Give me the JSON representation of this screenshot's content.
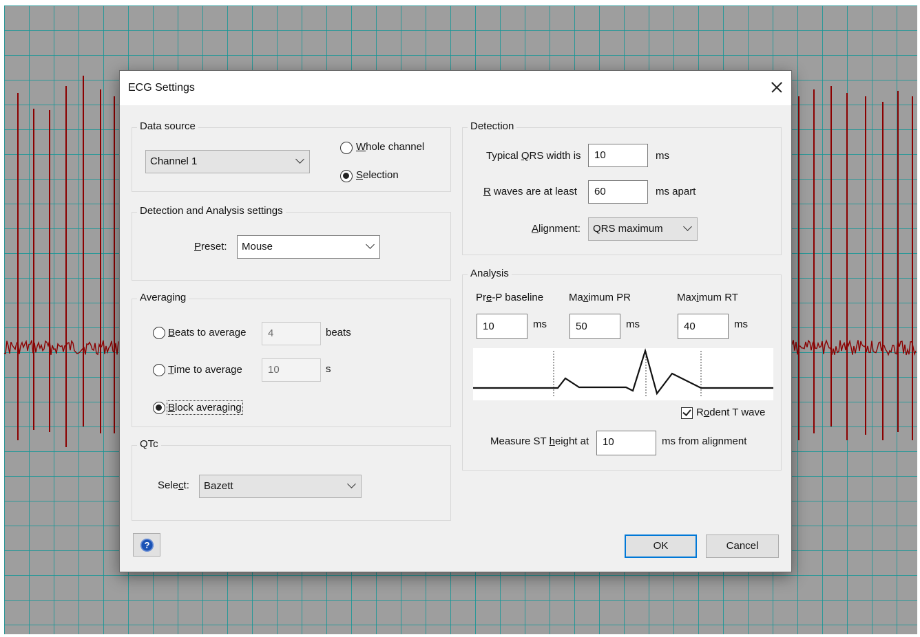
{
  "window": {
    "title": "ECG Settings",
    "close_icon": "close-icon"
  },
  "data_source": {
    "legend": "Data source",
    "channel": "Channel 1",
    "whole_channel": {
      "pre": "",
      "mn": "W",
      "post": "hole channel",
      "selected": false
    },
    "selection": {
      "pre": "",
      "mn": "S",
      "post": "election",
      "selected": true
    }
  },
  "detection_analysis": {
    "legend": "Detection and Analysis settings",
    "preset_label": {
      "pre": "",
      "mn": "P",
      "post": "reset:"
    },
    "preset_value": "Mouse"
  },
  "averaging": {
    "legend": "Averaging",
    "beats": {
      "pre": "",
      "mn": "B",
      "post": "eats to average",
      "value": "4",
      "unit": "beats",
      "selected": false
    },
    "time": {
      "pre": "",
      "mn": "T",
      "post": "ime to average",
      "value": "10",
      "unit": "s",
      "selected": false
    },
    "block": {
      "pre": "",
      "mn": "B",
      "post": "lock averaging",
      "selected": true
    }
  },
  "qtc": {
    "legend": "QTc",
    "select_label": {
      "pre": "Sele",
      "mn": "c",
      "post": "t:"
    },
    "select_value": "Bazett"
  },
  "detection": {
    "legend": "Detection",
    "qrs_label": {
      "pre": "Typical ",
      "mn": "Q",
      "post": "RS width is"
    },
    "qrs_value": "10",
    "qrs_unit": "ms",
    "rwave_label": {
      "pre": "",
      "mn": "R",
      "post": " waves are at least"
    },
    "rwave_value": "60",
    "rwave_unit": "ms apart",
    "alignment_label": {
      "pre": "",
      "mn": "A",
      "post": "lignment:"
    },
    "alignment_value": "QRS maximum"
  },
  "analysis": {
    "legend": "Analysis",
    "prep_label": {
      "pre": "Pr",
      "mn": "e",
      "post": "-P baseline"
    },
    "prep_value": "10",
    "prep_unit": "ms",
    "maxpr_label": {
      "pre": "Ma",
      "mn": "x",
      "post": "imum PR"
    },
    "maxpr_value": "50",
    "maxpr_unit": "ms",
    "maxrt_label": {
      "pre": "Max",
      "mn": "i",
      "post": "mum RT"
    },
    "maxrt_value": "40",
    "maxrt_unit": "ms",
    "rodent": {
      "pre": "R",
      "mn": "o",
      "post": "dent T wave",
      "checked": true
    },
    "st_label": {
      "pre": "Measure ST ",
      "mn": "h",
      "post": "eight at"
    },
    "st_value": "10",
    "st_unit": "ms from alignment"
  },
  "buttons": {
    "ok": "OK",
    "cancel": "Cancel",
    "help_icon": "help-icon",
    "help_glyph": "?"
  },
  "colors": {
    "trace": "#8b0000",
    "grid": "#1896964d",
    "accent": "#0078d7"
  }
}
